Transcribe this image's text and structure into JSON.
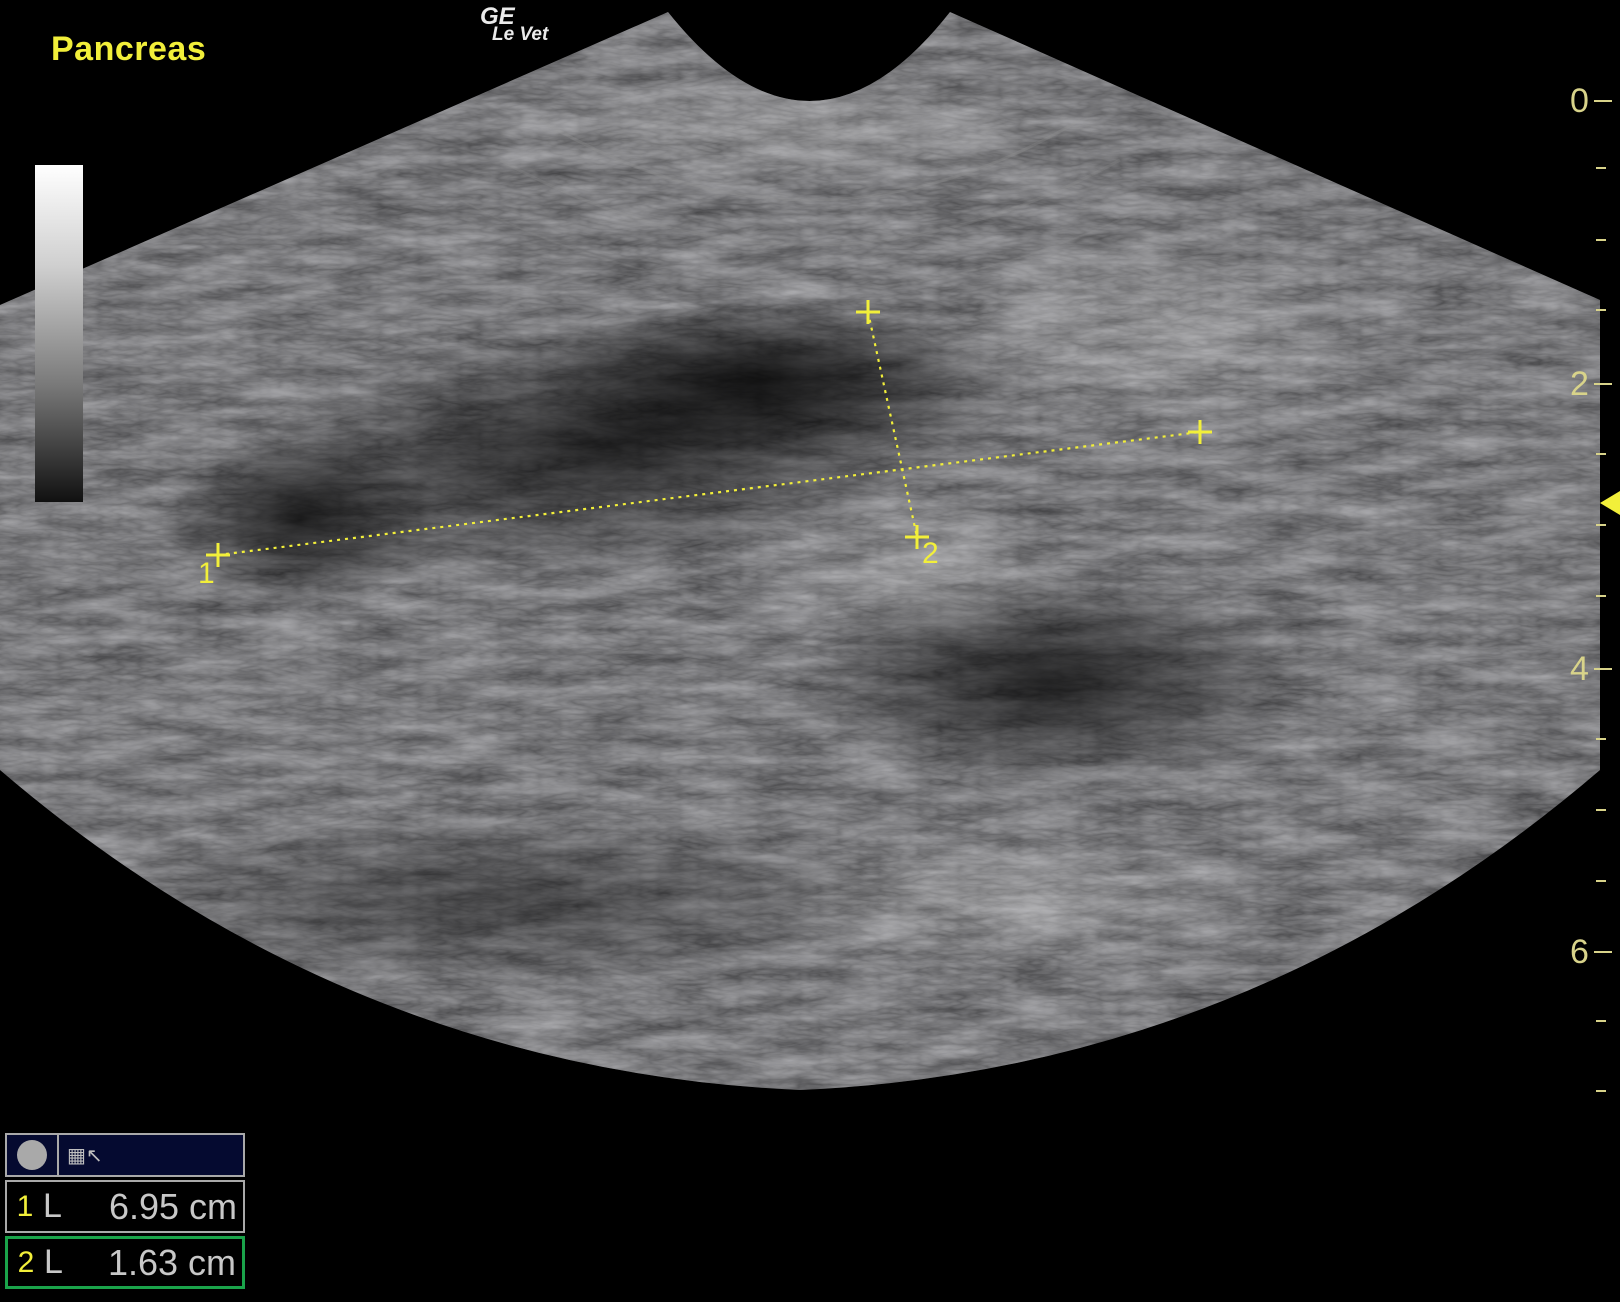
{
  "organ_label": "Pancreas",
  "brand": {
    "line1": "GE",
    "line2": "Le Vet"
  },
  "depth_scale": {
    "labels": [
      "0",
      "2",
      "4",
      "6"
    ]
  },
  "calipers": [
    {
      "id": "1"
    },
    {
      "id": "2"
    }
  ],
  "measurements": [
    {
      "index": "1",
      "type": "L",
      "value": "6.95 cm",
      "active": false
    },
    {
      "index": "2",
      "type": "L",
      "value": "1.63 cm",
      "active": true
    }
  ],
  "colors": {
    "annotation": "#f2ef3a",
    "scale": "#d8d38a",
    "active_border": "#1aa34a",
    "panel_bg": "#050a30"
  },
  "icons": [
    "record-circle-icon",
    "measure-tool-icon",
    "focus-marker-icon"
  ]
}
